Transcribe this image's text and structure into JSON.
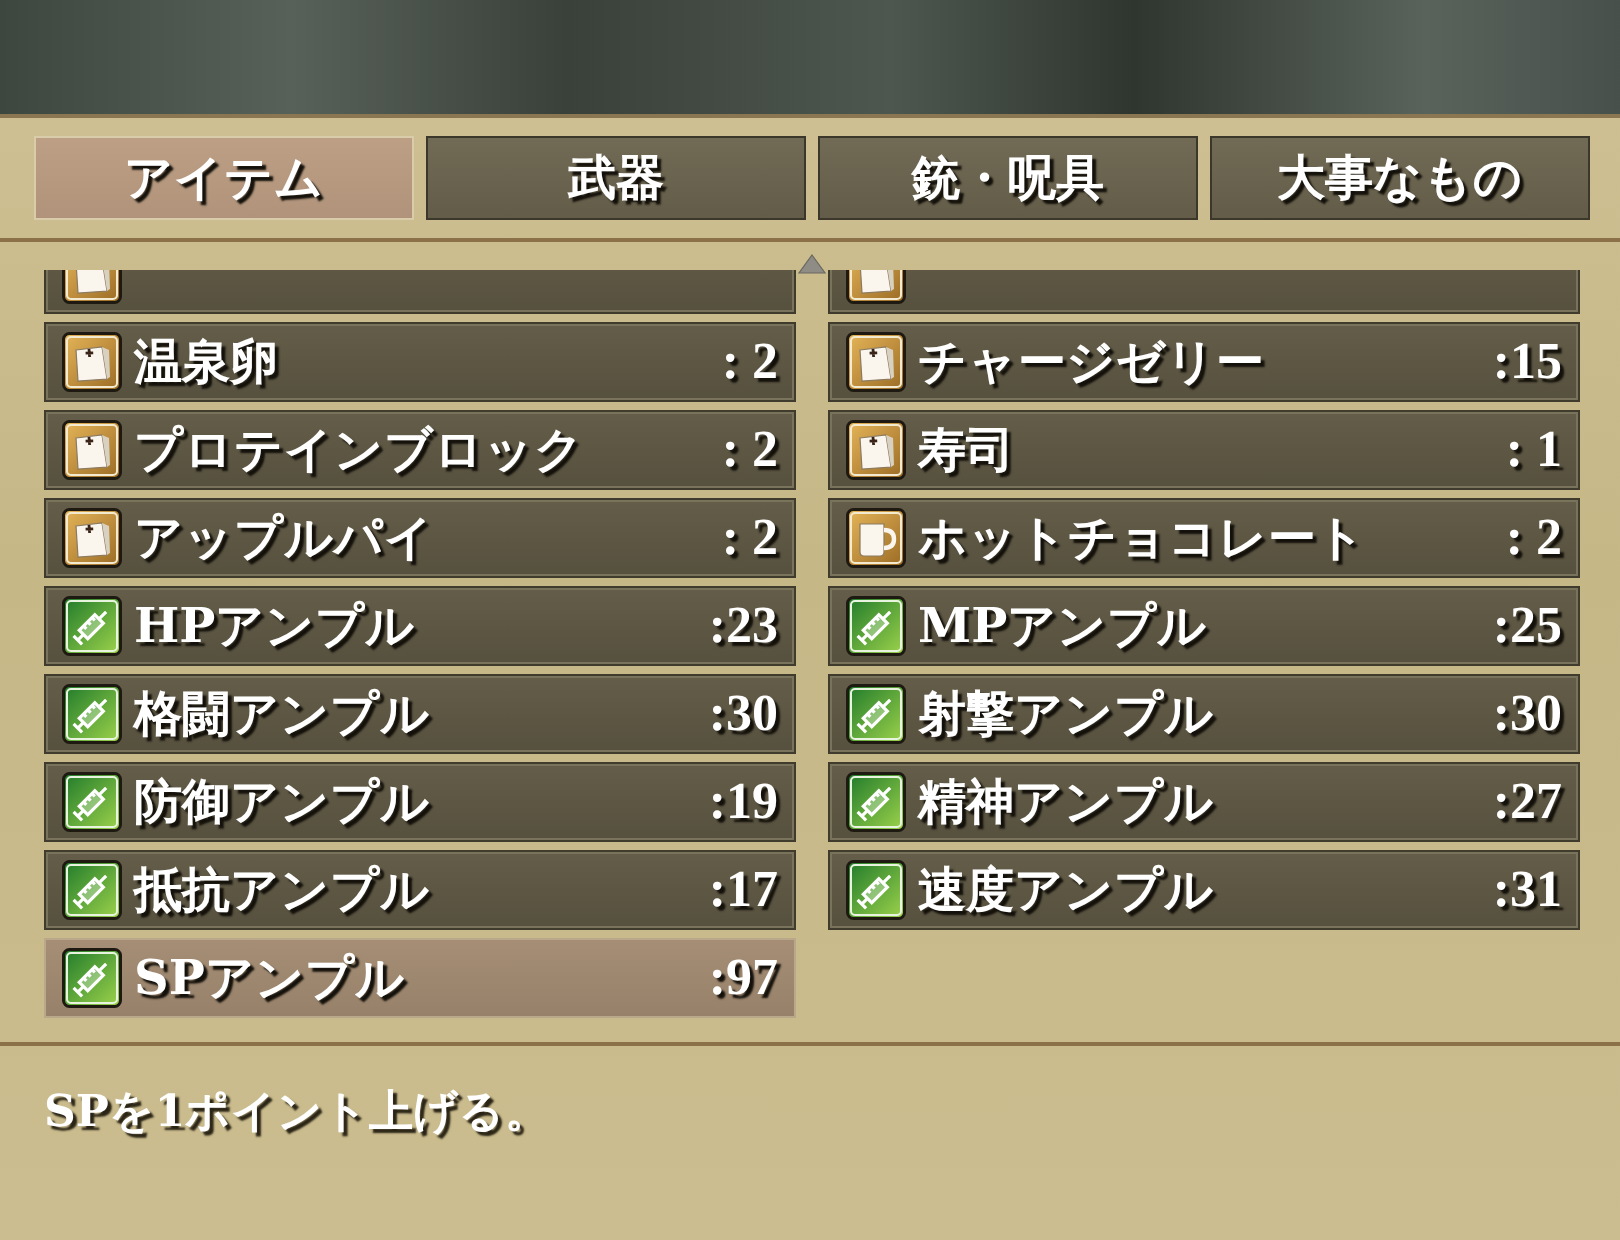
{
  "tabs": [
    {
      "label": "アイテム",
      "selected": true
    },
    {
      "label": "武器",
      "selected": false
    },
    {
      "label": "銃・呪具",
      "selected": false
    },
    {
      "label": "大事なもの",
      "selected": false
    }
  ],
  "items": [
    {
      "kind": "food",
      "selected": false
    },
    {
      "kind": "food",
      "selected": false
    },
    {
      "name": "温泉卵",
      "count": ": 2",
      "kind": "food",
      "selected": false
    },
    {
      "name": "チャージゼリー",
      "count": ":15",
      "kind": "food",
      "selected": false
    },
    {
      "name": "プロテインブロック",
      "count": ": 2",
      "kind": "food",
      "selected": false
    },
    {
      "name": "寿司",
      "count": ": 1",
      "kind": "food",
      "selected": false
    },
    {
      "name": "アップルパイ",
      "count": ": 2",
      "kind": "food",
      "selected": false
    },
    {
      "name": "ホットチョコレート",
      "count": ": 2",
      "kind": "drink",
      "selected": false
    },
    {
      "name": "HPアンプル",
      "count": ":23",
      "kind": "ampoule",
      "selected": false
    },
    {
      "name": "MPアンプル",
      "count": ":25",
      "kind": "ampoule",
      "selected": false
    },
    {
      "name": "格闘アンプル",
      "count": ":30",
      "kind": "ampoule",
      "selected": false
    },
    {
      "name": "射撃アンプル",
      "count": ":30",
      "kind": "ampoule",
      "selected": false
    },
    {
      "name": "防御アンプル",
      "count": ":19",
      "kind": "ampoule",
      "selected": false
    },
    {
      "name": "精神アンプル",
      "count": ":27",
      "kind": "ampoule",
      "selected": false
    },
    {
      "name": "抵抗アンプル",
      "count": ":17",
      "kind": "ampoule",
      "selected": false
    },
    {
      "name": "速度アンプル",
      "count": ":31",
      "kind": "ampoule",
      "selected": false
    },
    {
      "name": "SPアンプル",
      "count": ":97",
      "kind": "ampoule",
      "selected": true
    }
  ],
  "description": "SPを1ポイント上げる。"
}
